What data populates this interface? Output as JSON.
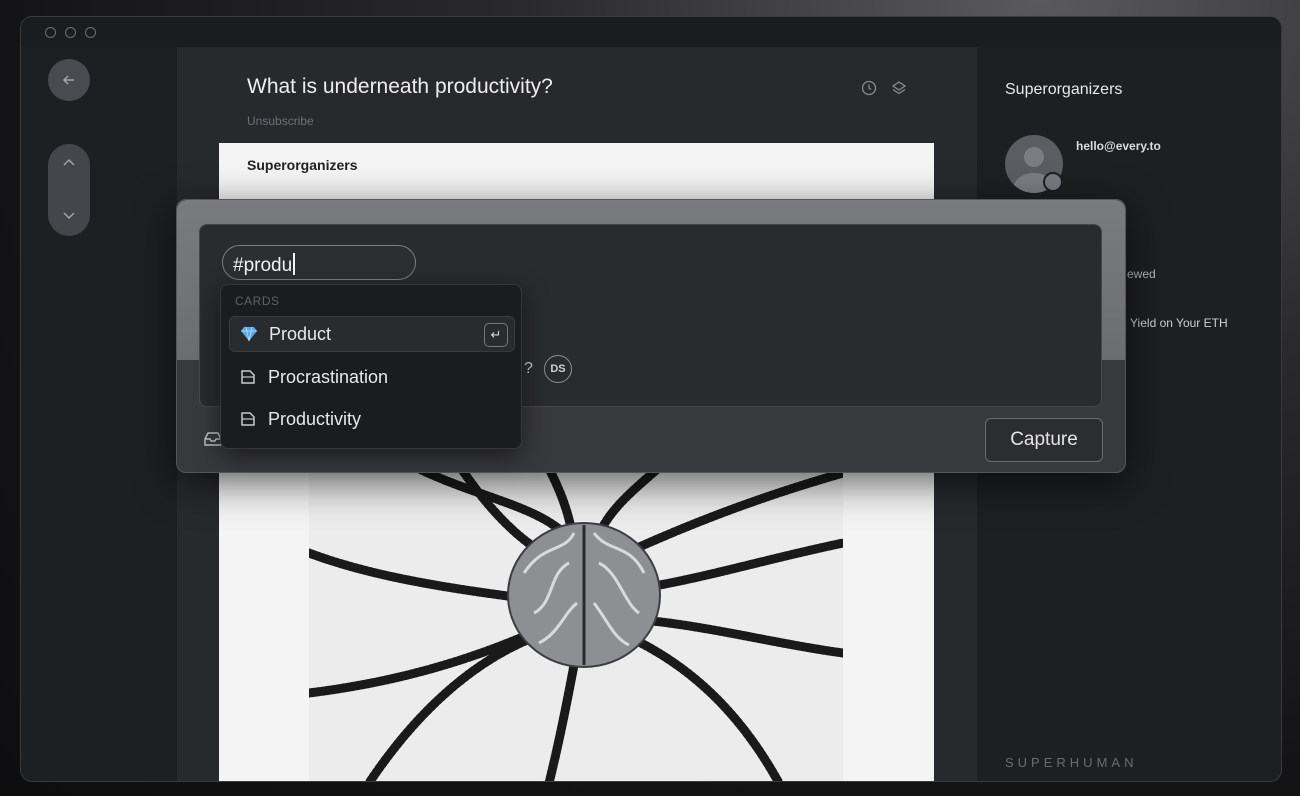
{
  "window": {
    "traffic_lights": [
      "close",
      "minimize",
      "zoom"
    ]
  },
  "nav": {
    "back_icon": "arrow-left-icon",
    "up_icon": "chevron-up-icon",
    "down_icon": "chevron-down-icon"
  },
  "email": {
    "subject": "What is underneath productivity?",
    "unsubscribe": "Unsubscribe",
    "card_header": "Superorganizers",
    "header_icons": [
      "clock-icon",
      "layers-icon"
    ]
  },
  "sidebar": {
    "title": "Superorganizers",
    "email": "hello@every.to",
    "fragment_1": "ewed",
    "fragment_2": "Yield on Your ETH",
    "brand": "SUPERHUMAN"
  },
  "capture": {
    "tag_input_value": "#produ",
    "question_mark": "?",
    "avatar_initials": "DS",
    "button_label": "Capture",
    "dropdown": {
      "section_label": "CARDS",
      "items": [
        {
          "label": "Product",
          "icon": "gem-icon",
          "selected": true
        },
        {
          "label": "Procrastination",
          "icon": "card-icon",
          "selected": false
        },
        {
          "label": "Productivity",
          "icon": "card-icon",
          "selected": false
        }
      ]
    }
  },
  "colors": {
    "accent_gem": "#5aa7f0",
    "window_bg": "#1d1e21",
    "panel_bg": "#28292d"
  }
}
